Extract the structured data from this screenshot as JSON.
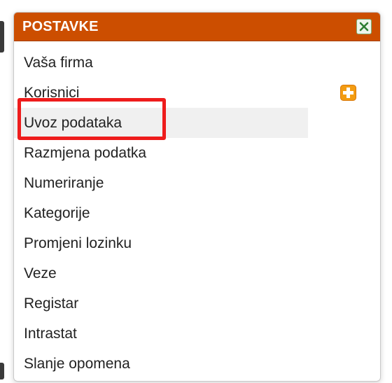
{
  "panel": {
    "title": "POSTAVKE",
    "header_color": "#cc4e00"
  },
  "menu": {
    "items": [
      {
        "label": "Vaša firma"
      },
      {
        "label": "Korisnici"
      },
      {
        "label": "Uvoz podataka"
      },
      {
        "label": "Razmjena podatka"
      },
      {
        "label": "Numeriranje"
      },
      {
        "label": "Kategorije"
      },
      {
        "label": "Promjeni lozinku"
      },
      {
        "label": "Veze"
      },
      {
        "label": "Registar"
      },
      {
        "label": "Intrastat"
      },
      {
        "label": "Slanje opomena"
      }
    ],
    "active_index": 2
  },
  "icons": {
    "close": "close-icon",
    "add": "add-icon"
  },
  "colors": {
    "accent": "#cc4e00",
    "highlight_border": "#ee1c1c",
    "add_icon": "#f39c12"
  }
}
